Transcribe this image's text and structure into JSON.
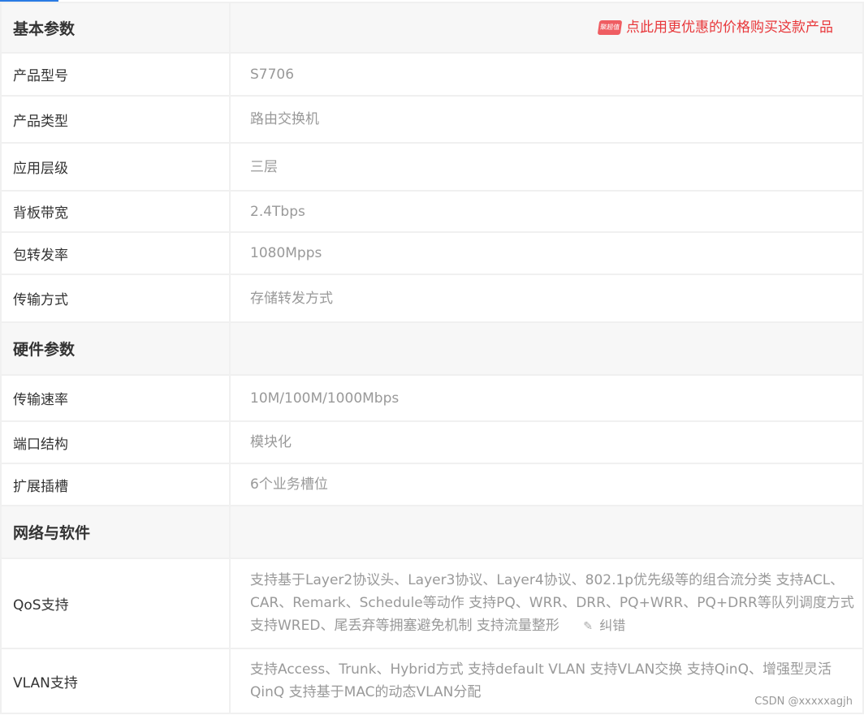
{
  "promo": {
    "label": "点此用更优惠的价格购买这款产品",
    "icon_text": "聚超值"
  },
  "sections": [
    {
      "title": "基本参数",
      "rows": [
        {
          "label": "产品型号",
          "value": "S7706"
        },
        {
          "label": "产品类型",
          "value": "路由交换机"
        },
        {
          "label": "应用层级",
          "value": "三层"
        },
        {
          "label": "背板带宽",
          "value": "2.4Tbps"
        },
        {
          "label": "包转发率",
          "value": "1080Mpps"
        },
        {
          "label": "传输方式",
          "value": "存储转发方式"
        }
      ]
    },
    {
      "title": "硬件参数",
      "rows": [
        {
          "label": "传输速率",
          "value": "10M/100M/1000Mbps"
        },
        {
          "label": "端口结构",
          "value": "模块化"
        },
        {
          "label": "扩展插槽",
          "value": "6个业务槽位"
        }
      ]
    },
    {
      "title": "网络与软件",
      "rows": [
        {
          "label": "QoS支持",
          "value": "支持基于Layer2协议头、Layer3协议、Layer4协议、802.1p优先级等的组合流分类 支持ACL、CAR、Remark、Schedule等动作 支持PQ、WRR、DRR、PQ+WRR、PQ+DRR等队列调度方式 支持WRED、尾丢弃等拥塞避免机制 支持流量整形"
        },
        {
          "label": "VLAN支持",
          "value": "支持Access、Trunk、Hybrid方式 支持default VLAN 支持VLAN交换 支持QinQ、增强型灵活QinQ 支持基于MAC的动态VLAN分配"
        }
      ]
    }
  ],
  "edit_link": {
    "label": "纠错",
    "icon": "pencil-icon"
  },
  "watermark": "CSDN @xxxxxagjh",
  "colors": {
    "accent": "#2a7be4",
    "promo": "#e8383b",
    "label": "#333333",
    "value": "#999999",
    "header_bg": "#f7f7f7"
  }
}
